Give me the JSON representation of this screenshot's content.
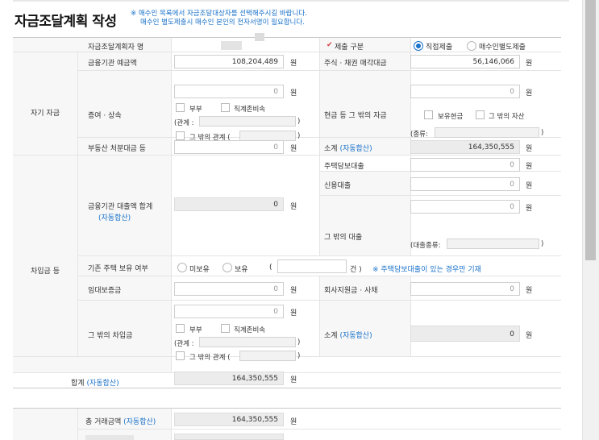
{
  "title": "자금조달계획 작성",
  "notice": {
    "line1": "※ 매수인 목록에서 자금조달대상자를 선택해주시길 바랍니다.",
    "line2": "매수인 별도제출시 매수인 본인의 전자서명이 필요합니다."
  },
  "planner": {
    "label": "자금조달계획자 명",
    "value": ""
  },
  "submit": {
    "mark": "✔",
    "label": "제출 구분",
    "options": [
      "직접제출",
      "매수인별도제출"
    ],
    "selected": "직접제출"
  },
  "own": {
    "section": "자기 자금",
    "deposit": {
      "label": "금융기관 예금액",
      "value": "108,204,489",
      "unit": "원"
    },
    "stock": {
      "label": "주식 · 채권 매각대금",
      "value": "56,146,066",
      "unit": "원"
    },
    "gift": {
      "label": "증여 · 상속",
      "value": "0",
      "unit": "원",
      "opt_spouse": "부부",
      "opt_lineal": "직계존비속",
      "relation_label": "(관계 :",
      "close": ")",
      "opt_other": "그 밖의 관계 ("
    },
    "cash": {
      "label": "현금 등 그 밖의 자금",
      "value": "0",
      "unit": "원",
      "opt_cash": "보유현금",
      "opt_asset": "그 밖의 자산",
      "type_label": "(종류:",
      "close": ")"
    },
    "realestate": {
      "label": "부동산 처분대금 등",
      "value": "0",
      "unit": "원"
    },
    "subtotal": {
      "label": "소계",
      "auto": "(자동합산)",
      "value": "164,350,555",
      "unit": "원"
    }
  },
  "loan": {
    "section": "차입금 등",
    "bank": {
      "label": "금융기관 대출액 합계",
      "auto": "(자동합산)",
      "value": "0",
      "unit": "원"
    },
    "mortgage": {
      "label": "주택담보대출",
      "value": "0",
      "unit": "원"
    },
    "credit": {
      "label": "신용대출",
      "value": "0",
      "unit": "원"
    },
    "other_loan": {
      "label": "그 밖의 대출",
      "value": "0",
      "unit": "원",
      "type_label": "(대출종류:",
      "close": ")"
    },
    "existing": {
      "label": "기존 주택 보유 여부",
      "opt_no": "미보유",
      "opt_yes": "보유",
      "open": "(",
      "count_unit": "건 )",
      "note": "※ 주택담보대출이 있는 경우만 기재"
    },
    "deposit": {
      "label": "임대보증금",
      "value": "0",
      "unit": "원"
    },
    "company": {
      "label": "회사지원금 · 사채",
      "value": "0",
      "unit": "원"
    },
    "other": {
      "label": "그 밖의 차입금",
      "value": "0",
      "unit": "원",
      "opt_spouse": "부부",
      "opt_lineal": "직계존비속",
      "relation_label": "(관계 :",
      "close": ")",
      "opt_other": "그 밖의 관계 ("
    },
    "subtotal": {
      "label": "소계",
      "auto": "(자동합산)",
      "value": "0",
      "unit": "원"
    }
  },
  "total": {
    "label": "합계",
    "auto": "(자동합산)",
    "value": "164,350,555",
    "unit": "원"
  },
  "deal": {
    "label": "총 거래금액",
    "auto": "(자동합산)",
    "value": "164,350,555",
    "unit": "원"
  }
}
